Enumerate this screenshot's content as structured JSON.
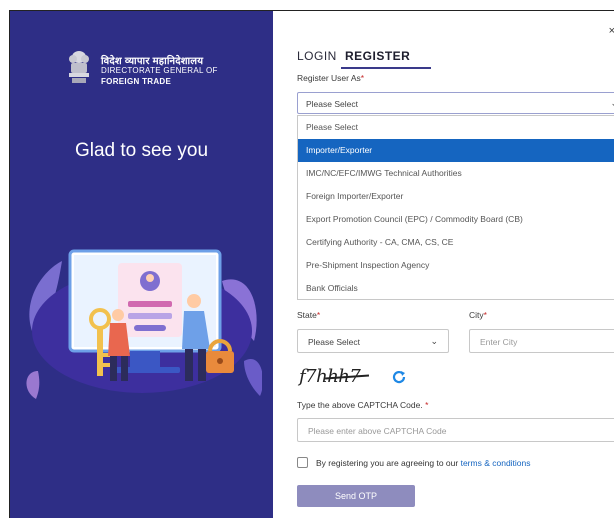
{
  "brand": {
    "hindi_name": "विदेश व्यापार महानिदेशालय",
    "line1": "DIRECTORATE GENERAL OF",
    "line2": "FOREIGN TRADE",
    "tagline": "Glad to see you"
  },
  "tabs": {
    "login": "LOGIN",
    "register": "REGISTER",
    "active": "REGISTER"
  },
  "close_symbol": "×",
  "register_as": {
    "label": "Register User As",
    "required_mark": "*",
    "selected": "Please Select",
    "options": [
      {
        "label": "Please Select",
        "active": false
      },
      {
        "label": "Importer/Exporter",
        "active": true
      },
      {
        "label": "IMC/NC/EFC/IMWG Technical Authorities",
        "active": false
      },
      {
        "label": "Foreign Importer/Exporter",
        "active": false
      },
      {
        "label": "Export Promotion Council (EPC) / Commodity Board (CB)",
        "active": false
      },
      {
        "label": "Certifying Authority - CA, CMA, CS, CE",
        "active": false
      },
      {
        "label": "Pre-Shipment Inspection Agency",
        "active": false
      },
      {
        "label": "Bank Officials",
        "active": false
      }
    ]
  },
  "state": {
    "label": "State",
    "required_mark": "*",
    "value": "Please Select"
  },
  "city": {
    "label": "City",
    "required_mark": "*",
    "placeholder": "Enter City"
  },
  "captcha": {
    "image_text": "f7hhh7",
    "label": "Type the above CAPTCHA Code.",
    "required_mark": "*",
    "placeholder": "Please enter above CAPTCHA Code"
  },
  "agreement": {
    "text": "By registering you are agreeing to our ",
    "link": "terms & conditions"
  },
  "send_otp_label": "Send OTP",
  "colors": {
    "panel": "#2e2e86",
    "accent": "#3a3a8a",
    "highlight": "#1565c0",
    "button": "#8e8cbe",
    "required": "#c62828"
  }
}
